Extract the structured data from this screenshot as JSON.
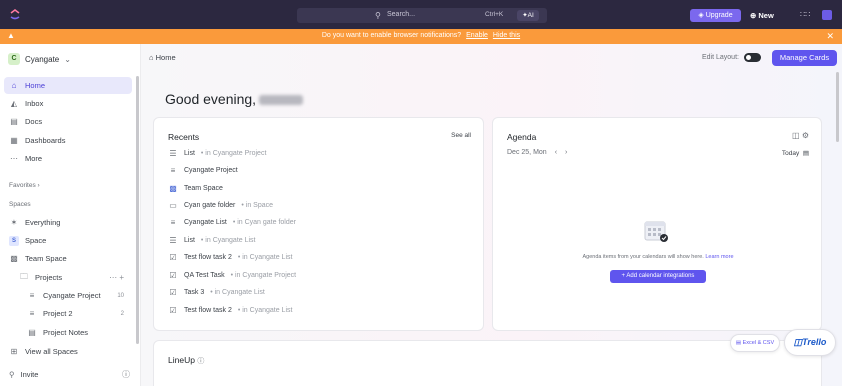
{
  "topbar": {
    "search_placeholder": "Search...",
    "search_shortcut": "Ctrl+K",
    "ai_label": "AI",
    "upgrade_label": "Upgrade",
    "new_label": "New",
    "colors": {
      "bg": "#2c2840",
      "accent": "#7b68ee"
    }
  },
  "notification": {
    "message": "Do you want to enable browser notifications?",
    "enable": "Enable",
    "hide": "Hide this",
    "color": "#fa9a3b"
  },
  "sidebar": {
    "workspace": {
      "initial": "C",
      "name": "Cyangate"
    },
    "nav": [
      {
        "label": "Home",
        "icon": "home-icon",
        "active": true
      },
      {
        "label": "Inbox",
        "icon": "inbox-icon"
      },
      {
        "label": "Docs",
        "icon": "doc-icon"
      },
      {
        "label": "Dashboards",
        "icon": "dashboard-icon"
      },
      {
        "label": "More",
        "icon": "more-icon"
      }
    ],
    "favorites_label": "Favorites",
    "spaces_label": "Spaces",
    "spaces": [
      {
        "label": "Everything",
        "icon": "everything-icon"
      },
      {
        "label": "Space",
        "badge": "S"
      },
      {
        "label": "Team Space",
        "icon": "team-icon"
      },
      {
        "label": "Projects",
        "icon": "folder-icon"
      },
      {
        "label": "Cyangate Project",
        "icon": "list-icon",
        "count": "10"
      },
      {
        "label": "Project 2",
        "icon": "list-icon",
        "count": "2"
      },
      {
        "label": "Project Notes",
        "icon": "doc-icon"
      },
      {
        "label": "View all Spaces",
        "icon": "grid-icon"
      }
    ],
    "invite_label": "Invite"
  },
  "main": {
    "breadcrumb": "Home",
    "edit_layout": "Edit Layout:",
    "manage_cards": "Manage Cards",
    "greeting": "Good evening,",
    "recents": {
      "title": "Recents",
      "see_all": "See all",
      "items": [
        {
          "name": "List",
          "loc": "• in Cyangate Project",
          "icon": "list-icon"
        },
        {
          "name": "Cyangate Project",
          "loc": "",
          "icon": "list-lines-icon"
        },
        {
          "name": "Team Space",
          "loc": "",
          "icon": "team-icon"
        },
        {
          "name": "Cyan gate folder",
          "loc": "• in Space",
          "icon": "folder-icon"
        },
        {
          "name": "Cyangate List",
          "loc": "• in Cyan gate folder",
          "icon": "list-lines-icon"
        },
        {
          "name": "List",
          "loc": "• in Cyangate List",
          "icon": "list-icon"
        },
        {
          "name": "Test flow task 2",
          "loc": "• in Cyangate List",
          "icon": "task-icon"
        },
        {
          "name": "QA Test Task",
          "loc": "• in Cyangate Project",
          "icon": "task-icon"
        },
        {
          "name": "Task 3",
          "loc": "• in Cyangate List",
          "icon": "task-icon"
        },
        {
          "name": "Test flow task 2",
          "loc": "• in Cyangate List",
          "icon": "task-icon"
        }
      ]
    },
    "agenda": {
      "title": "Agenda",
      "date": "Dec 25, Mon",
      "today": "Today",
      "message": "Agenda items from your calendars will show here.",
      "learn_more": "Learn more",
      "add_button": "+ Add calendar integrations"
    },
    "lineup": {
      "title": "LineUp"
    },
    "import_excel": "Excel & CSV",
    "import_trello": "Trello"
  }
}
